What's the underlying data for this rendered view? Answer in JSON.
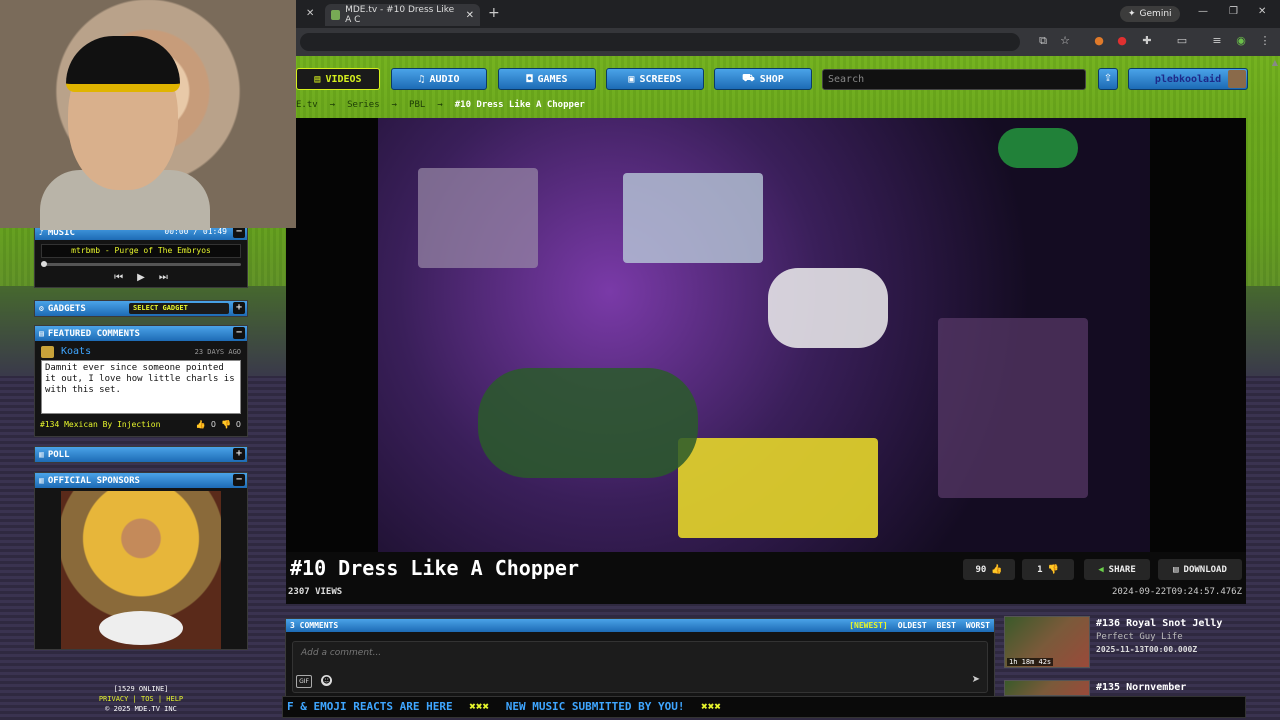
{
  "browser": {
    "tab_title": "MDE.tv - #10 Dress Like A C",
    "tab_close": "✕",
    "new_tab": "+",
    "gemini": "Gemini",
    "win_min": "—",
    "win_max": "❐",
    "win_close": "✕"
  },
  "nav": {
    "items": [
      {
        "label": "VIDEOS",
        "icon": "▤"
      },
      {
        "label": "AUDIO",
        "icon": "♫"
      },
      {
        "label": "GAMES",
        "icon": "◘"
      },
      {
        "label": "SCREEDS",
        "icon": "▣"
      },
      {
        "label": "SHOP",
        "icon": "⛟"
      }
    ],
    "search_placeholder": "Search",
    "upload_icon": "⇪",
    "username": "plebkoolaid"
  },
  "breadcrumb": {
    "items": [
      "E.tv",
      "Series",
      "PBL"
    ],
    "separator": "→",
    "current": "#10 Dress Like A Chopper"
  },
  "video": {
    "title": "#10 Dress Like A Chopper",
    "views": "2307 VIEWS",
    "timestamp": "2024-09-22T09:24:57.476Z",
    "likes": "90",
    "dislikes": "1",
    "share_label": "SHARE",
    "download_label": "DOWNLOAD"
  },
  "comments": {
    "header": "3 COMMENTS",
    "sort": [
      "[NEWEST]",
      "OLDEST",
      "BEST",
      "WORST"
    ],
    "placeholder": "Add a comment...",
    "gif_label": "GIF"
  },
  "related": [
    {
      "title": "#136 Royal Snot Jelly",
      "subtitle": "Perfect Guy Life",
      "date": "2025-11-13T00:00.000Z",
      "duration": "1h 18m 42s"
    },
    {
      "title": "#135 Nornvember",
      "subtitle": "",
      "date": "",
      "duration": ""
    }
  ],
  "ticker": {
    "text1": "F & EMOJI REACTS ARE HERE",
    "sep": "✖✖✖",
    "text2": "NEW MUSIC SUBMITTED BY YOU!",
    "sep2": "✖✖✖"
  },
  "sidebar": {
    "music": {
      "title": "MUSIC",
      "time": "00:00 / 01:49",
      "track": "mtrbmb - Purge of The Embryos",
      "progress": 0
    },
    "gadgets": {
      "title": "GADGETS",
      "select": "SELECT GADGET"
    },
    "featured": {
      "title": "FEATURED COMMENTS",
      "user": "Koats",
      "age": "23 DAYS AGO",
      "body": "Damnit ever since someone pointed it out, I love how little charls is with this set.",
      "video": "#134 Mexican By Injection",
      "up": "0",
      "down": "0"
    },
    "poll": {
      "title": "POLL"
    },
    "sponsors": {
      "title": "OFFICIAL SPONSORS"
    }
  },
  "footer": {
    "online": "[1529 ONLINE]",
    "links": "PRIVACY | TOS | HELP",
    "copyright": "© 2025 MDE.TV INC"
  }
}
